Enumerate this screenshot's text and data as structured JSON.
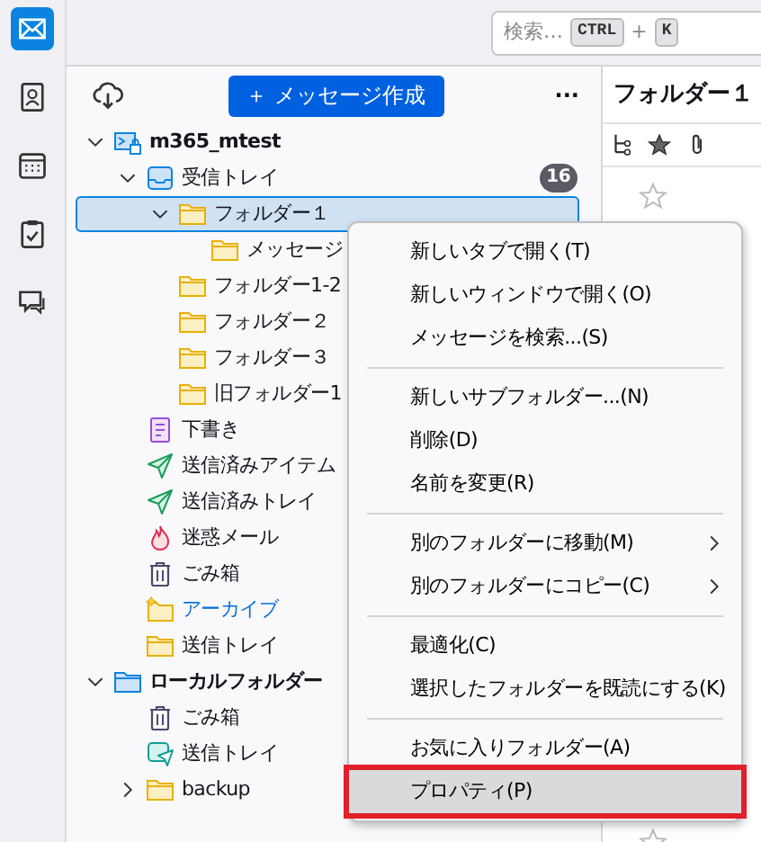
{
  "rail": [
    {
      "kind": "mail",
      "selected": true
    },
    {
      "kind": "contacts",
      "selected": false
    },
    {
      "kind": "calendar",
      "selected": false
    },
    {
      "kind": "tasks",
      "selected": false
    },
    {
      "kind": "chat",
      "selected": false
    }
  ],
  "search": {
    "placeholder": "検索…",
    "keys": [
      "CTRL",
      "+",
      "K"
    ]
  },
  "folder_pane": {
    "compose_button": "＋ メッセージ作成",
    "more": "···",
    "tree": [
      {
        "label": "m365_mtest",
        "kind": "account",
        "expanded": true,
        "selected": false,
        "children": [
          {
            "label": "受信トレイ",
            "kind": "inbox",
            "expanded": true,
            "selected": false,
            "badge": "16",
            "children": [
              {
                "label": "フォルダー１",
                "kind": "folder",
                "expanded": true,
                "selected": true,
                "children": [
                  {
                    "label": "メッセージ",
                    "kind": "folder",
                    "selected": false
                  }
                ]
              },
              {
                "label": "フォルダー1-2",
                "kind": "folder",
                "selected": false
              },
              {
                "label": "フォルダー２",
                "kind": "folder",
                "selected": false
              },
              {
                "label": "フォルダー３",
                "kind": "folder",
                "selected": false
              },
              {
                "label": "旧フォルダー1",
                "kind": "folder",
                "selected": false
              }
            ]
          },
          {
            "label": "下書き",
            "kind": "drafts",
            "selected": false
          },
          {
            "label": "送信済みアイテム",
            "kind": "sent",
            "selected": false
          },
          {
            "label": "送信済みトレイ",
            "kind": "sent",
            "selected": false
          },
          {
            "label": "迷惑メール",
            "kind": "junk",
            "selected": false
          },
          {
            "label": "ごみ箱",
            "kind": "trash",
            "selected": false
          },
          {
            "label": "アーカイブ",
            "kind": "archive",
            "selected": false
          },
          {
            "label": "送信トレイ",
            "kind": "folder",
            "selected": false
          }
        ]
      },
      {
        "label": "ローカルフォルダー",
        "kind": "local",
        "expanded": true,
        "selected": false,
        "children": [
          {
            "label": "ごみ箱",
            "kind": "trash",
            "selected": false
          },
          {
            "label": "送信トレイ",
            "kind": "outbox",
            "selected": false
          },
          {
            "label": "backup",
            "kind": "folder",
            "expanded": false,
            "selected": false
          }
        ]
      }
    ]
  },
  "message_pane": {
    "title": "フォルダー１"
  },
  "context_menu": [
    [
      {
        "label": "新しいタブで開く(T)",
        "submenu": false,
        "hovered": false,
        "outlined": false
      },
      {
        "label": "新しいウィンドウで開く(O)",
        "submenu": false,
        "hovered": false,
        "outlined": false
      },
      {
        "label": "メッセージを検索...(S)",
        "submenu": false,
        "hovered": false,
        "outlined": false
      }
    ],
    [
      {
        "label": "新しいサブフォルダー...(N)",
        "submenu": false,
        "hovered": false,
        "outlined": false
      },
      {
        "label": "削除(D)",
        "submenu": false,
        "hovered": false,
        "outlined": false
      },
      {
        "label": "名前を変更(R)",
        "submenu": false,
        "hovered": false,
        "outlined": false
      }
    ],
    [
      {
        "label": "別のフォルダーに移動(M)",
        "submenu": true,
        "hovered": false,
        "outlined": false
      },
      {
        "label": "別のフォルダーにコピー(C)",
        "submenu": true,
        "hovered": false,
        "outlined": false
      }
    ],
    [
      {
        "label": "最適化(C)",
        "submenu": false,
        "hovered": false,
        "outlined": false
      },
      {
        "label": "選択したフォルダーを既読にする(K)",
        "submenu": false,
        "hovered": false,
        "outlined": false
      }
    ],
    [
      {
        "label": "お気に入りフォルダー(A)",
        "submenu": false,
        "hovered": false,
        "outlined": false
      },
      {
        "label": "プロパティ(P)",
        "submenu": false,
        "hovered": true,
        "outlined": true
      }
    ]
  ]
}
